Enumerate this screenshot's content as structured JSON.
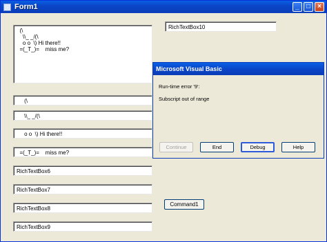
{
  "window": {
    "title": "Form1",
    "buttons": {
      "minimize": "_",
      "maximize": "□",
      "close": "×"
    }
  },
  "richtextboxes": {
    "box1": "  (\\\n    \\\\_ _/(\\\n    o o  \\) Hi there!!\n  =(_T_)=    miss me?",
    "box2": "     (\\",
    "box3": "     \\\\_ _/(\\",
    "box4": "     o o  \\) Hi there!!",
    "box5": "  =(_T_)=    miss me?",
    "box6": "RichTextBox6",
    "box7": "RichTextBox7",
    "box8": "RichTextBox8",
    "box9": "RichTextBox9",
    "box10": "RichTextBox10"
  },
  "command_button": {
    "label": "Command1"
  },
  "dialog": {
    "title": "Microsoft Visual Basic",
    "error_line": "Run-time error '9':",
    "message": "Subscript out of range",
    "buttons": {
      "continue": "Continue",
      "end": "End",
      "debug": "Debug",
      "help": "Help"
    }
  }
}
